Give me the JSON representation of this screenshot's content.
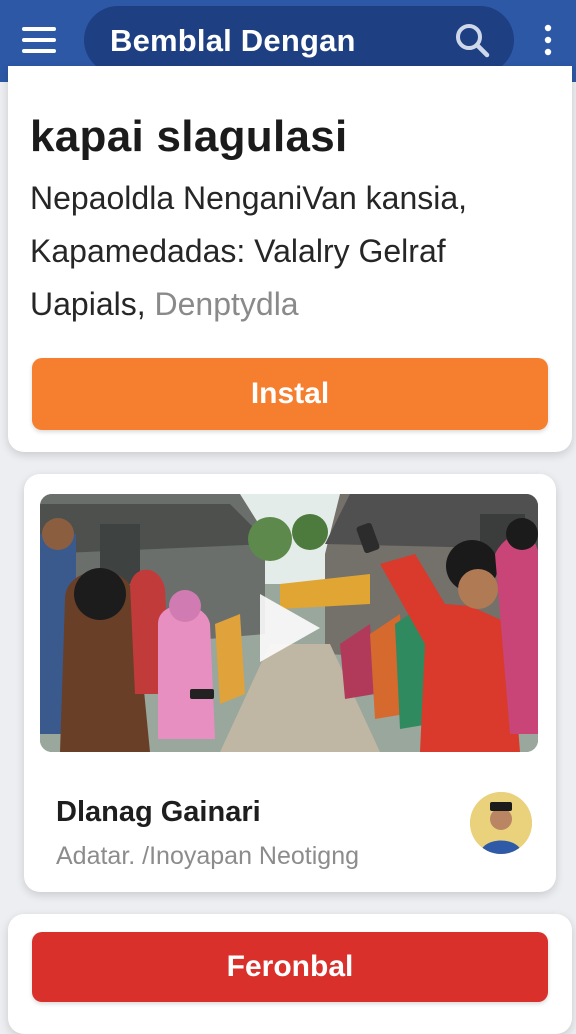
{
  "header": {
    "title": "Bemblal Dengan",
    "menu_icon": "hamburger-menu-icon",
    "search_icon": "search-icon",
    "more_icon": "more-vertical-icon",
    "bar_color": "#2d58a6",
    "pill_color": "#1e3f82"
  },
  "app_card": {
    "title": "kapai slagulasi",
    "description_line1": "Nepaoldla NenganiVan kansia,",
    "description_line2": "Kapamedadas: Valalry Gelraf",
    "description_line3": "Uapials,",
    "description_muted": "Denptydla",
    "install_label": "Instal",
    "install_color": "#f57f2e"
  },
  "media_card": {
    "thumbnail": "video-thumbnail-people-with-phones-in-village-street",
    "play_icon": "play-icon",
    "title": "Dlanag Gainari",
    "subtitle": "Adatar. /Inoyapan Neotigng",
    "avatar": "user-avatar"
  },
  "bottom_card": {
    "button_label": "Feronbal",
    "button_color": "#d9302b"
  }
}
